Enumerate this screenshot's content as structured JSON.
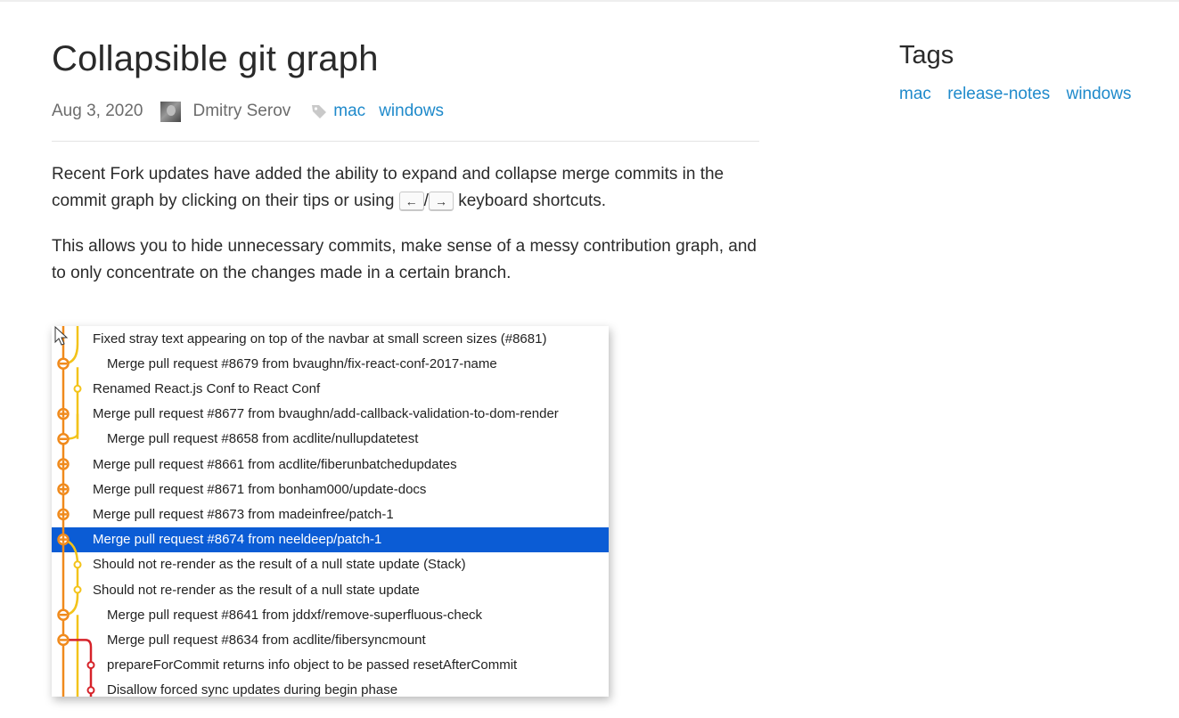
{
  "post": {
    "title": "Collapsible git graph",
    "date": "Aug 3, 2020",
    "author": "Dmitry Serov",
    "tags": [
      "mac",
      "windows"
    ]
  },
  "body": {
    "p1_a": "Recent Fork updates have added the ability to expand and collapse merge commits in the commit graph by clicking on their tips or using",
    "key_left": "←",
    "slash": "/",
    "key_right": "→",
    "p1_b": "keyboard shortcuts.",
    "p2": "This allows you to hide unnecessary commits, make sense of a messy contribution graph, and to only concentrate on the changes made in a certain branch."
  },
  "sidebar": {
    "title": "Tags",
    "tags": [
      "mac",
      "release-notes",
      "windows"
    ]
  },
  "colors": {
    "link": "#1f8acb",
    "selected_row": "#0b5cd5",
    "graph_orange": "#f08a1c",
    "graph_yellow": "#f3c31a",
    "graph_red": "#d6232a"
  },
  "commits": [
    {
      "message": "Fixed stray text appearing on top of the navbar at small screen sizes (#8681)",
      "indent": 0,
      "selected": false
    },
    {
      "message": "Merge pull request #8679 from bvaughn/fix-react-conf-2017-name",
      "indent": 1,
      "selected": false
    },
    {
      "message": "Renamed React.js Conf to React Conf",
      "indent": 0,
      "selected": false
    },
    {
      "message": "Merge pull request #8677 from bvaughn/add-callback-validation-to-dom-render",
      "indent": 0,
      "selected": false
    },
    {
      "message": "Merge pull request #8658 from acdlite/nullupdatetest",
      "indent": 1,
      "selected": false
    },
    {
      "message": "Merge pull request #8661 from acdlite/fiberunbatchedupdates",
      "indent": 0,
      "selected": false
    },
    {
      "message": "Merge pull request #8671 from bonham000/update-docs",
      "indent": 0,
      "selected": false
    },
    {
      "message": "Merge pull request #8673 from madeinfree/patch-1",
      "indent": 0,
      "selected": false
    },
    {
      "message": "Merge pull request #8674 from neeldeep/patch-1",
      "indent": 0,
      "selected": true
    },
    {
      "message": "Should not re-render as the result of a null state update (Stack)",
      "indent": 0,
      "selected": false
    },
    {
      "message": "Should not re-render as the result of a null state update",
      "indent": 0,
      "selected": false
    },
    {
      "message": "Merge pull request #8641 from jddxf/remove-superfluous-check",
      "indent": 1,
      "selected": false
    },
    {
      "message": "Merge pull request #8634 from acdlite/fibersyncmount",
      "indent": 1,
      "selected": false
    },
    {
      "message": "prepareForCommit returns info object to be passed resetAfterCommit",
      "indent": 1,
      "selected": false
    },
    {
      "message": "Disallow forced sync updates during begin phase",
      "indent": 1,
      "selected": false
    }
  ]
}
